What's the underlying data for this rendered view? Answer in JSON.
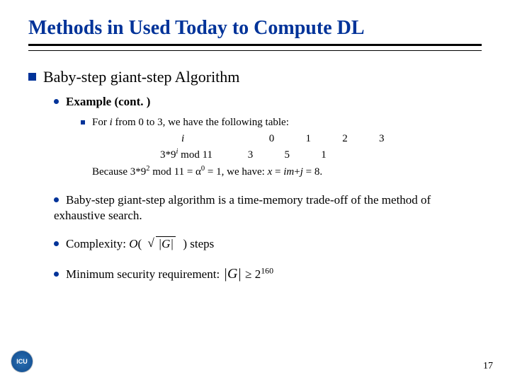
{
  "title": "Methods in Used Today to Compute DL",
  "l1": {
    "heading": "Baby-step giant-step Algorithm"
  },
  "example": {
    "label": "Example (cont. )"
  },
  "table": {
    "intro_a": "For ",
    "intro_i": "i",
    "intro_b": " from 0 to 3, we have the following table:",
    "row1_label": "i",
    "row2_label_a": "3*9",
    "row2_label_sup": "i",
    "row2_label_b": " mod 11",
    "cols": [
      "0",
      "1",
      "2",
      "3"
    ],
    "vals": [
      "3",
      "5",
      "1",
      ""
    ],
    "because_a": "Because 3*9",
    "because_sup": "2",
    "because_b": " mod 11 = α",
    "because_sup2": "0",
    "because_c": " = 1, we have: ",
    "because_x": "x",
    "because_eq": " = ",
    "because_im": "im",
    "because_plus": "+",
    "because_j": "j",
    "because_end": " = 8."
  },
  "tradeoff": "Baby-step giant-step algorithm is a time-memory trade-off of the method of exhaustive search.",
  "complexity": {
    "a": "Complexity: ",
    "O": "O",
    "open": "(",
    "sqrt_inner": "G",
    "close": ") steps"
  },
  "security": {
    "a": "Minimum security requirement:    ",
    "abs_inner": "G",
    "geq": " ≥ 2",
    "exp": "160"
  },
  "logo": "ICU",
  "page": "17"
}
